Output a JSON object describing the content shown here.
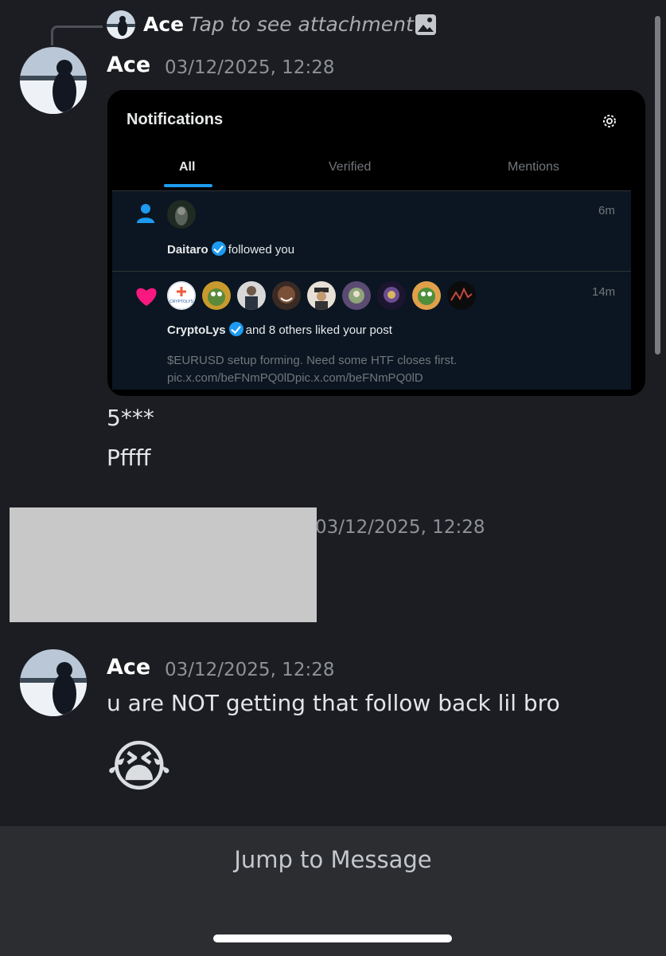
{
  "reply_preview": {
    "author": "Ace",
    "text": "Tap to see attachment",
    "icon": "image-icon"
  },
  "messages": [
    {
      "author": "Ace",
      "timestamp": "03/12/2025, 12:28",
      "embed": {
        "title": "Notifications",
        "settings_icon": "gear-icon",
        "tabs": [
          {
            "label": "All",
            "active": true
          },
          {
            "label": "Verified",
            "active": false
          },
          {
            "label": "Mentions",
            "active": false
          }
        ],
        "notifications": [
          {
            "type_icon": "person-icon",
            "time": "6m",
            "user": "Daitaro",
            "verified": true,
            "action": "followed you"
          },
          {
            "type_icon": "heart-icon",
            "time": "14m",
            "user": "CryptoLys",
            "verified": true,
            "action": "and 8 others liked your post",
            "post_text": "$EURUSD setup forming. Need some HTF closes first.",
            "post_link": "pic.x.com/beFNmPQ0lDpic.x.com/beFNmPQ0lD",
            "first_avatar_label": "CRYPTOLYS"
          }
        ]
      },
      "lines": [
        "5***",
        "Pffff"
      ]
    },
    {
      "author": "",
      "timestamp": "03/12/2025, 12:28",
      "redacted": true
    },
    {
      "author": "Ace",
      "timestamp": "03/12/2025, 12:28",
      "lines": [
        "u are NOT getting that follow back lil bro",
        "😭"
      ]
    }
  ],
  "jump_button": "Jump to Message",
  "colors": {
    "background": "#1c1d22",
    "x_blue": "#1d9bf0",
    "heart": "#f91880"
  }
}
